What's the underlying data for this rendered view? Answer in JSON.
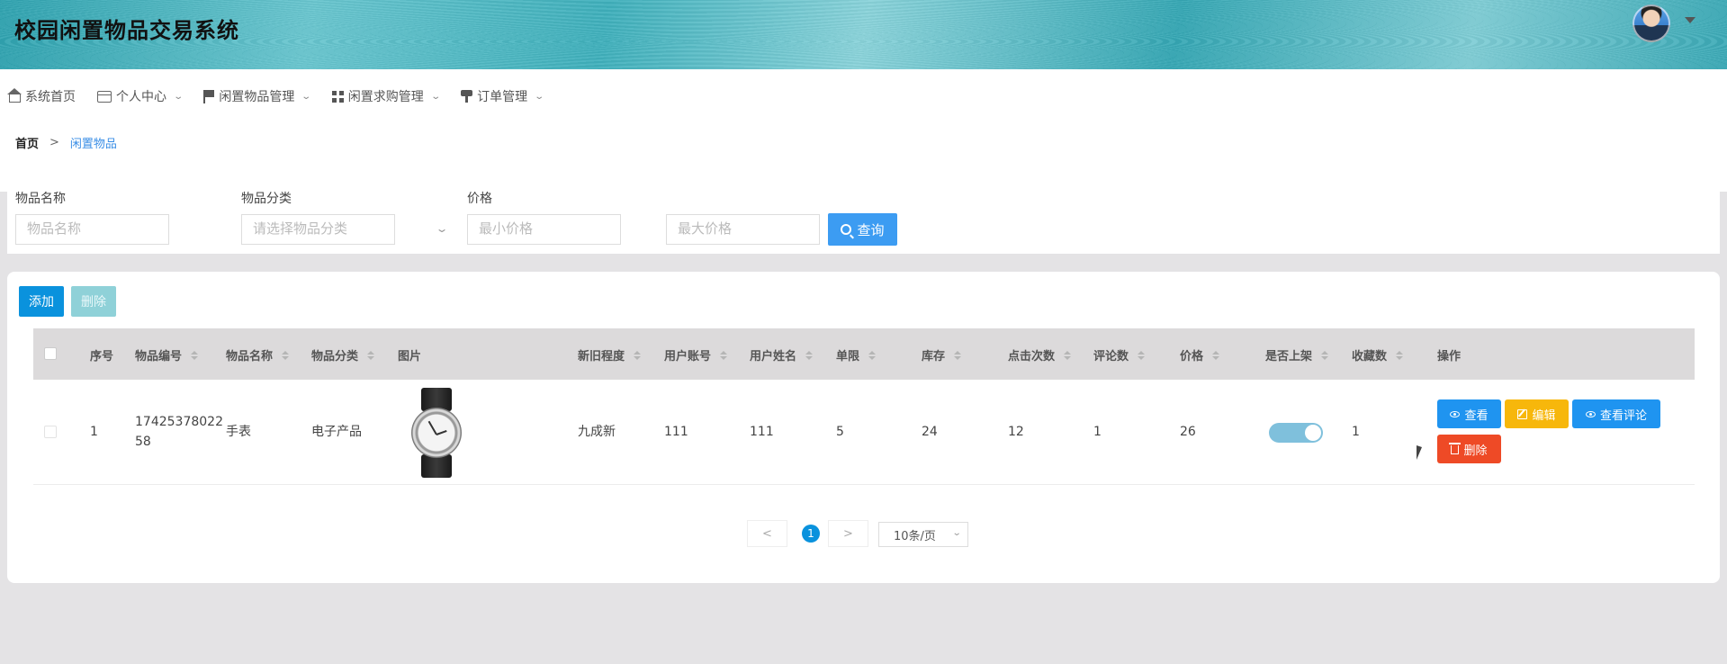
{
  "app": {
    "title": "校园闲置物品交易系统"
  },
  "nav": [
    {
      "label": "系统首页",
      "icon": "home-icon"
    },
    {
      "label": "个人中心",
      "icon": "card-icon",
      "has_dropdown": true
    },
    {
      "label": "闲置物品管理",
      "icon": "flag-icon",
      "has_dropdown": true
    },
    {
      "label": "闲置求购管理",
      "icon": "grid-icon",
      "has_dropdown": true
    },
    {
      "label": "订单管理",
      "icon": "stamp-icon",
      "has_dropdown": true
    }
  ],
  "breadcrumb": {
    "home": "首页",
    "separator": ">",
    "current": "闲置物品"
  },
  "search": {
    "name_label": "物品名称",
    "name_placeholder": "物品名称",
    "category_label": "物品分类",
    "category_placeholder": "请选择物品分类",
    "price_label": "价格",
    "min_placeholder": "最小价格",
    "max_placeholder": "最大价格",
    "query_label": "查询"
  },
  "toolbar": {
    "add_label": "添加",
    "delete_label": "删除"
  },
  "table": {
    "headers": {
      "index": "序号",
      "code": "物品编号",
      "name": "物品名称",
      "category": "物品分类",
      "image": "图片",
      "condition": "新旧程度",
      "account": "用户账号",
      "username": "用户姓名",
      "limit": "单限",
      "stock": "库存",
      "clicks": "点击次数",
      "comments": "评论数",
      "price": "价格",
      "listed": "是否上架",
      "favorites": "收藏数",
      "actions": "操作"
    },
    "rows": [
      {
        "index": "1",
        "code_line1": "17425378022",
        "code_line2": "58",
        "name": "手表",
        "category": "电子产品",
        "image": "watch-image",
        "condition": "九成新",
        "account": "111",
        "username": "111",
        "limit": "5",
        "stock": "24",
        "clicks": "12",
        "comments": "1",
        "price": "26",
        "listed": true,
        "favorites": "1",
        "actions": {
          "view": "查看",
          "edit": "编辑",
          "view_comments": "查看评论",
          "delete": "删除"
        }
      }
    ]
  },
  "pagination": {
    "prev": "<",
    "current": "1",
    "next": ">",
    "page_size": "10条/页"
  },
  "colors": {
    "primary": "#0a92dd",
    "warning": "#f7b70b",
    "danger": "#ee4a26",
    "header_bg": "#dcdadb"
  }
}
